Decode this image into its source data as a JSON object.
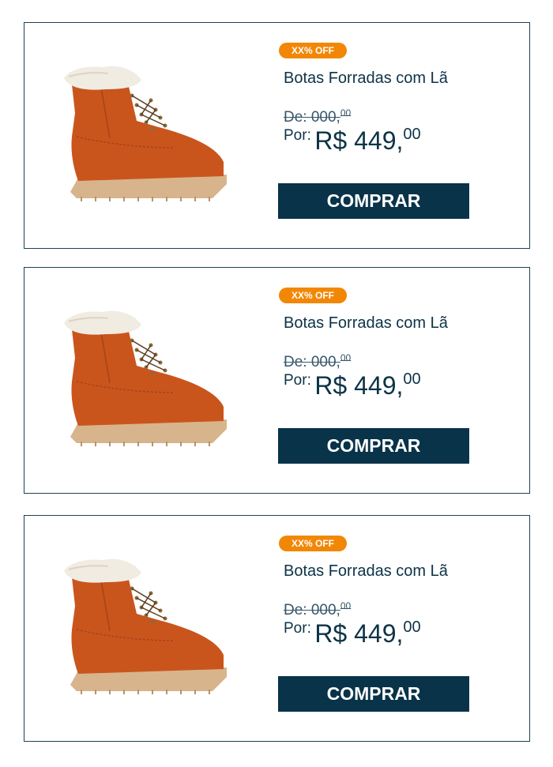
{
  "products": [
    {
      "badge": "XX% OFF",
      "title": "Botas Forradas com Lã",
      "old_price_label": "De:",
      "old_price_value": "000,",
      "old_price_cents": "00",
      "price_label": "Por:",
      "price_value": "R$ 449,",
      "price_cents": "00",
      "button_label": "COMPRAR",
      "image_icon": "orange-lined-boot-image"
    },
    {
      "badge": "XX% OFF",
      "title": "Botas Forradas com Lã",
      "old_price_label": "De:",
      "old_price_value": "000,",
      "old_price_cents": "00",
      "price_label": "Por:",
      "price_value": "R$ 449,",
      "price_cents": "00",
      "button_label": "COMPRAR",
      "image_icon": "orange-lined-boot-image"
    },
    {
      "badge": "XX% OFF",
      "title": "Botas Forradas com Lã",
      "old_price_label": "De:",
      "old_price_value": "000,",
      "old_price_cents": "00",
      "price_label": "Por:",
      "price_value": "R$ 449,",
      "price_cents": "00",
      "button_label": "COMPRAR",
      "image_icon": "orange-lined-boot-image"
    }
  ],
  "colors": {
    "badge_bg": "#f28705",
    "button_bg": "#083349",
    "text_primary": "#0d3347",
    "card_border": "#1f4255",
    "boot_suede": "#c9551d",
    "boot_sole": "#d8b48c",
    "boot_fur": "#f1ece2"
  }
}
